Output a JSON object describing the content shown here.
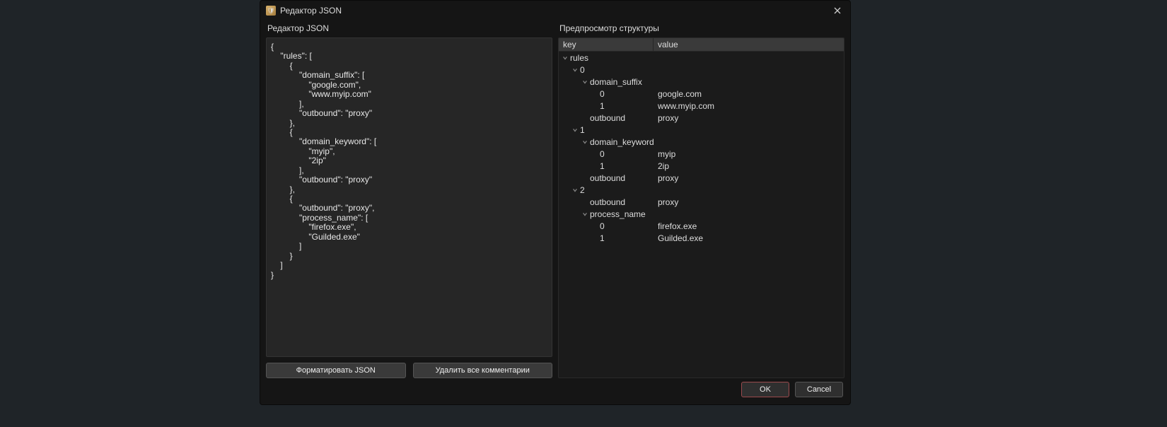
{
  "window": {
    "title": "Редактор JSON"
  },
  "editor": {
    "label": "Редактор JSON",
    "content": "{\n    \"rules\": [\n        {\n            \"domain_suffix\": [\n                \"google.com\",\n                \"www.myip.com\"\n            ],\n            \"outbound\": \"proxy\"\n        },\n        {\n            \"domain_keyword\": [\n                \"myip\",\n                \"2ip\"\n            ],\n            \"outbound\": \"proxy\"\n        },\n        {\n            \"outbound\": \"proxy\",\n            \"process_name\": [\n                \"firefox.exe\",\n                \"Guilded.exe\"\n            ]\n        }\n    ]\n}",
    "format_btn": "Форматировать JSON",
    "strip_comments_btn": "Удалить все комментарии"
  },
  "preview": {
    "label": "Предпросмотр структуры",
    "col_key": "key",
    "col_value": "value",
    "rows": [
      {
        "indent": 0,
        "expandable": true,
        "key": "rules",
        "value": ""
      },
      {
        "indent": 1,
        "expandable": true,
        "key": "0",
        "value": ""
      },
      {
        "indent": 2,
        "expandable": true,
        "key": "domain_suffix",
        "value": ""
      },
      {
        "indent": 3,
        "expandable": false,
        "key": "0",
        "value": "google.com"
      },
      {
        "indent": 3,
        "expandable": false,
        "key": "1",
        "value": "www.myip.com"
      },
      {
        "indent": 2,
        "expandable": false,
        "key": "outbound",
        "value": "proxy"
      },
      {
        "indent": 1,
        "expandable": true,
        "key": "1",
        "value": ""
      },
      {
        "indent": 2,
        "expandable": true,
        "key": "domain_keyword",
        "value": ""
      },
      {
        "indent": 3,
        "expandable": false,
        "key": "0",
        "value": "myip"
      },
      {
        "indent": 3,
        "expandable": false,
        "key": "1",
        "value": "2ip"
      },
      {
        "indent": 2,
        "expandable": false,
        "key": "outbound",
        "value": "proxy"
      },
      {
        "indent": 1,
        "expandable": true,
        "key": "2",
        "value": ""
      },
      {
        "indent": 2,
        "expandable": false,
        "key": "outbound",
        "value": "proxy"
      },
      {
        "indent": 2,
        "expandable": true,
        "key": "process_name",
        "value": ""
      },
      {
        "indent": 3,
        "expandable": false,
        "key": "0",
        "value": "firefox.exe"
      },
      {
        "indent": 3,
        "expandable": false,
        "key": "1",
        "value": "Guilded.exe"
      }
    ]
  },
  "footer": {
    "ok": "OK",
    "cancel": "Cancel"
  }
}
